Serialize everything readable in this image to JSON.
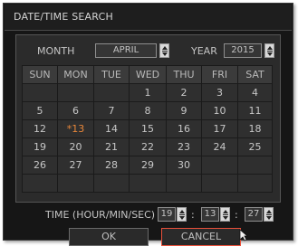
{
  "dialog": {
    "title": "DATE/TIME SEARCH"
  },
  "month": {
    "label": "MONTH",
    "value": "APRIL"
  },
  "year": {
    "label": "YEAR",
    "value": "2015"
  },
  "weekdays": [
    "SUN",
    "MON",
    "TUE",
    "WED",
    "THU",
    "FRI",
    "SAT"
  ],
  "weeks": [
    [
      "",
      "",
      "",
      "1",
      "2",
      "3",
      "4"
    ],
    [
      "5",
      "6",
      "7",
      "8",
      "9",
      "10",
      "11"
    ],
    [
      "12",
      "*13",
      "14",
      "15",
      "16",
      "17",
      "18"
    ],
    [
      "19",
      "20",
      "21",
      "22",
      "23",
      "24",
      "25"
    ],
    [
      "26",
      "27",
      "28",
      "29",
      "30",
      "",
      ""
    ],
    [
      "",
      "",
      "",
      "",
      "",
      "",
      ""
    ]
  ],
  "highlighted_day": "*13",
  "highlight_color": "#e8873a",
  "time": {
    "label": "TIME (HOUR/MIN/SEC)",
    "hour": "19",
    "minute": "13",
    "second": "27",
    "separator": ":"
  },
  "buttons": {
    "ok": "OK",
    "cancel": "CANCEL"
  },
  "focus_color": "#e8503a"
}
